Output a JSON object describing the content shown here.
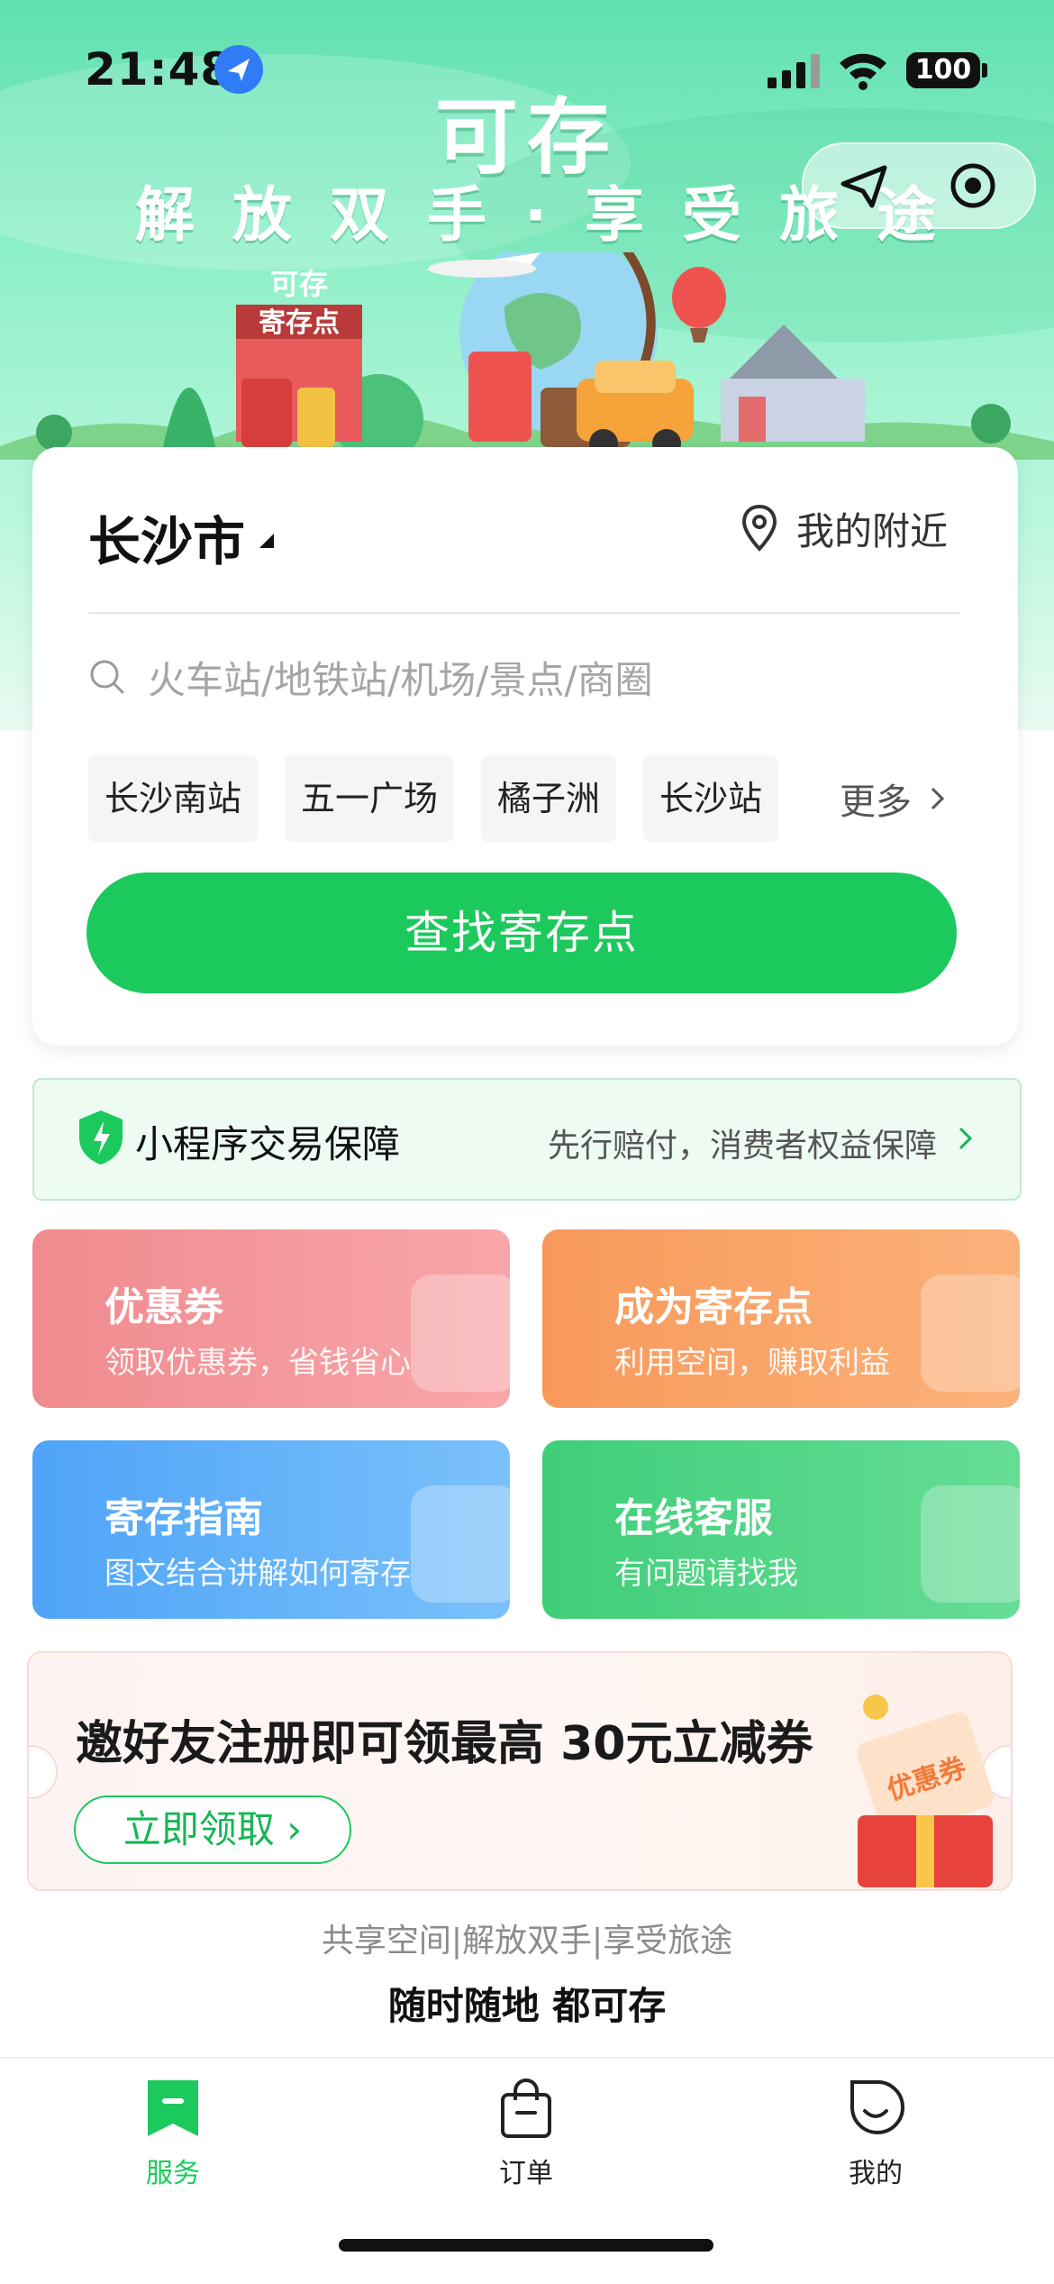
{
  "status_bar": {
    "time": "21:48",
    "battery": "100"
  },
  "hero": {
    "brand": "可存",
    "slogan": "解放双手·享受旅途",
    "sign_top": "可存",
    "sign_board": "寄存点"
  },
  "search_card": {
    "city": "长沙市",
    "nearby_label": "我的附近",
    "search_placeholder": "火车站/地铁站/机场/景点/商圈",
    "quick_tags": [
      "长沙南站",
      "五一广场",
      "橘子洲",
      "长沙站"
    ],
    "more_label": "更多",
    "find_button": "查找寄存点"
  },
  "guarantee": {
    "title": "小程序交易保障",
    "description": "先行赔付，消费者权益保障"
  },
  "tiles": [
    {
      "title": "优惠券",
      "subtitle": "领取优惠券，省钱省心"
    },
    {
      "title": "成为寄存点",
      "subtitle": "利用空间，赚取利益"
    },
    {
      "title": "寄存指南",
      "subtitle": "图文结合讲解如何寄存"
    },
    {
      "title": "在线客服",
      "subtitle": "有问题请找我"
    }
  ],
  "invite": {
    "title": "邀好友注册即可领最高 30元立减券",
    "button": "立即领取 ›",
    "badge": "优惠券"
  },
  "footer": {
    "line1": "共享空间|解放双手|享受旅途",
    "line2": "随时随地 都可存"
  },
  "tabbar": {
    "service": "服务",
    "order": "订单",
    "mine": "我的",
    "active": "服务"
  },
  "colors": {
    "primary": "#1cc95c",
    "coupon": "#f08a8f",
    "become": "#f8995b",
    "guide": "#4fa4f7",
    "service": "#3fce7a"
  }
}
